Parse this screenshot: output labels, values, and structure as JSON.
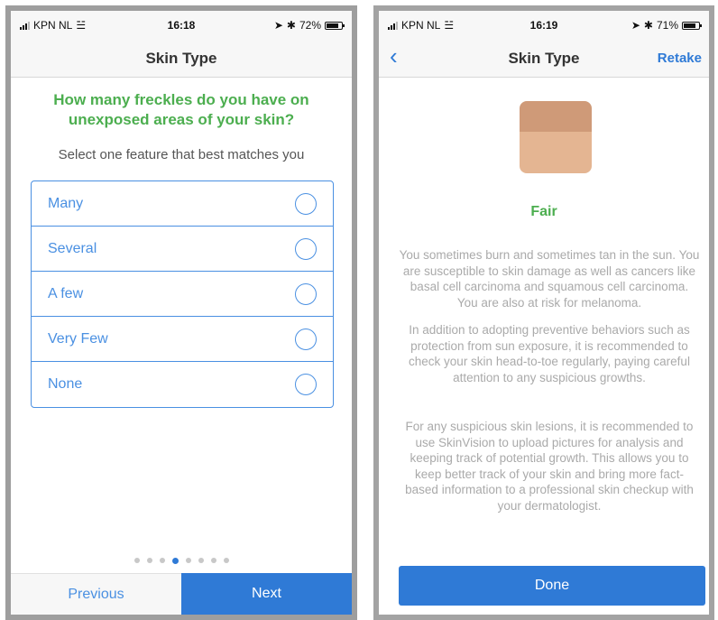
{
  "left_screen": {
    "status": {
      "carrier": "KPN NL",
      "time": "16:18",
      "battery": "72%"
    },
    "nav": {
      "title": "Skin Type"
    },
    "question": "How many freckles do you have on unexposed areas of your skin?",
    "instruction": "Select one feature that best matches you",
    "options": [
      {
        "label": "Many"
      },
      {
        "label": "Several"
      },
      {
        "label": "A few"
      },
      {
        "label": "Very Few"
      },
      {
        "label": "None"
      }
    ],
    "page_indicator": {
      "total": 8,
      "current": 4
    },
    "footer": {
      "previous_label": "Previous",
      "next_label": "Next"
    }
  },
  "right_screen": {
    "status": {
      "carrier": "KPN NL",
      "time": "16:19",
      "battery": "71%"
    },
    "nav": {
      "back_icon": "chevron-left-icon",
      "title": "Skin Type",
      "retake_label": "Retake"
    },
    "swatch_colors": {
      "top": "#cf9a78",
      "bottom": "#e4b592"
    },
    "skin_type": "Fair",
    "paragraphs": [
      "You sometimes burn and sometimes tan in the sun. You are susceptible to skin damage as well as cancers like basal cell carcinoma and squamous cell carcinoma. You are also at risk for melanoma.",
      "In addition to adopting preventive behaviors such as protection from sun exposure, it is recommended to check your skin head-to-toe regularly, paying careful attention to any suspicious growths.",
      "For any suspicious skin lesions, it is recommended to use SkinVision to upload pictures for analysis and keeping track of potential growth. This allows you to keep better track of your skin and bring more fact-based information to a professional skin checkup with your dermatologist."
    ],
    "done_label": "Done"
  },
  "colors": {
    "accent_blue": "#2f7ad6",
    "option_blue": "#4a90e2",
    "question_green": "#4cae4f"
  }
}
